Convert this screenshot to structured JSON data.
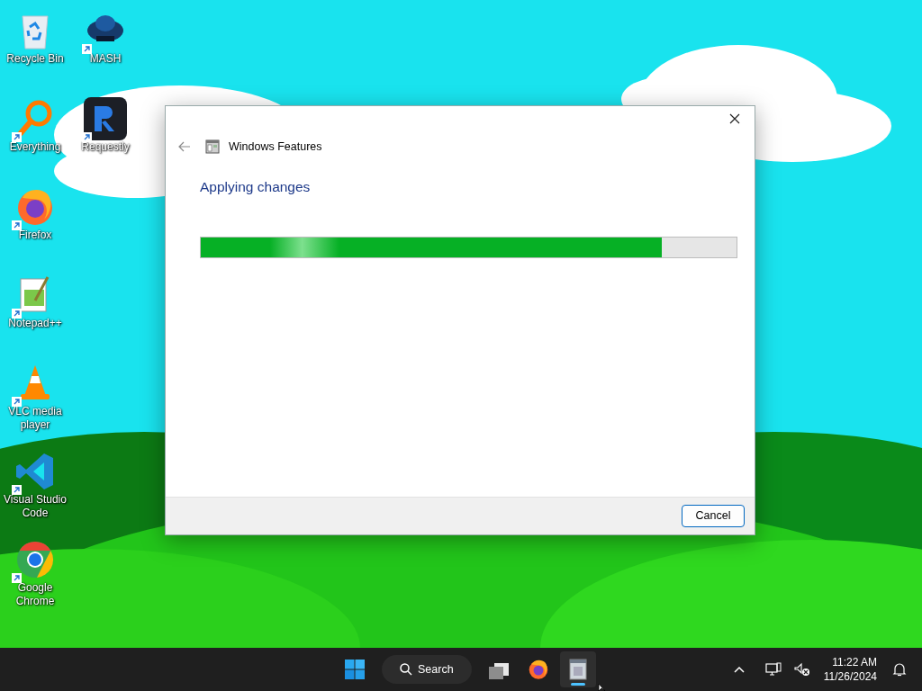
{
  "desktop_icons": [
    {
      "label": "Recycle Bin",
      "kind": "recycle",
      "shortcut": false
    },
    {
      "label": "Everything",
      "kind": "everything",
      "shortcut": true
    },
    {
      "label": "Firefox",
      "kind": "firefox",
      "shortcut": true
    },
    {
      "label": "Notepad++",
      "kind": "notepad",
      "shortcut": true
    },
    {
      "label": "VLC media player",
      "kind": "vlc",
      "shortcut": true
    },
    {
      "label": "Visual Studio Code",
      "kind": "vscode",
      "shortcut": true
    },
    {
      "label": "Google Chrome",
      "kind": "chrome",
      "shortcut": true
    },
    {
      "label": "MASH",
      "kind": "mash",
      "shortcut": true
    },
    {
      "label": "Requestly",
      "kind": "requestly",
      "shortcut": true
    }
  ],
  "dialog": {
    "title": "Windows Features",
    "heading": "Applying changes",
    "progress": {
      "level": 0.86
    },
    "buttons": [
      "Cancel"
    ]
  },
  "taskbar": {
    "search": "Search",
    "apps": [
      {
        "kind": "taskview",
        "active": false
      },
      {
        "kind": "firefox",
        "active": false
      },
      {
        "kind": "features",
        "active": true
      }
    ],
    "time": "11:22 AM",
    "date": "11/26/2024"
  }
}
